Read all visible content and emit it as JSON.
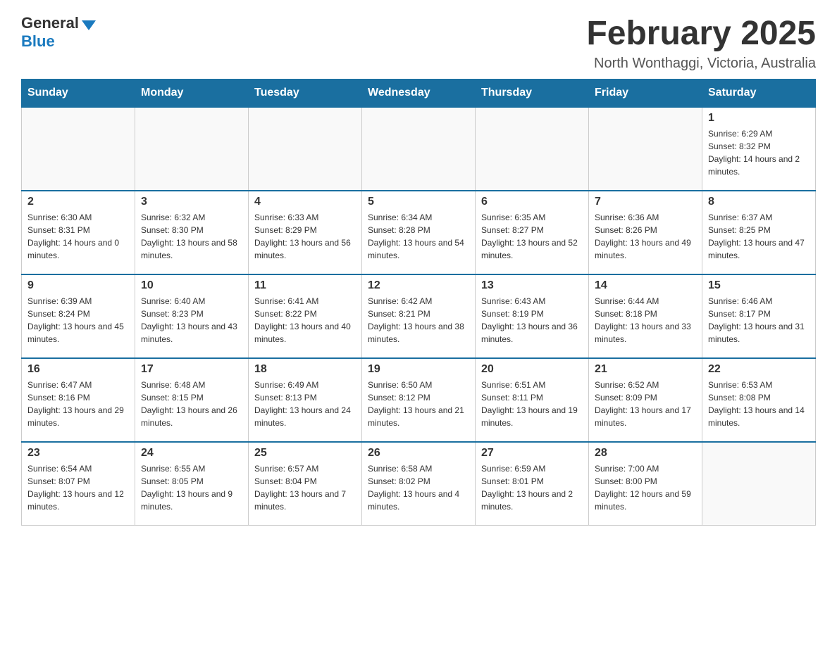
{
  "header": {
    "logo_general": "General",
    "logo_blue": "Blue",
    "title": "February 2025",
    "location": "North Wonthaggi, Victoria, Australia"
  },
  "days_of_week": [
    "Sunday",
    "Monday",
    "Tuesday",
    "Wednesday",
    "Thursday",
    "Friday",
    "Saturday"
  ],
  "weeks": [
    [
      {
        "day": "",
        "info": ""
      },
      {
        "day": "",
        "info": ""
      },
      {
        "day": "",
        "info": ""
      },
      {
        "day": "",
        "info": ""
      },
      {
        "day": "",
        "info": ""
      },
      {
        "day": "",
        "info": ""
      },
      {
        "day": "1",
        "info": "Sunrise: 6:29 AM\nSunset: 8:32 PM\nDaylight: 14 hours and 2 minutes."
      }
    ],
    [
      {
        "day": "2",
        "info": "Sunrise: 6:30 AM\nSunset: 8:31 PM\nDaylight: 14 hours and 0 minutes."
      },
      {
        "day": "3",
        "info": "Sunrise: 6:32 AM\nSunset: 8:30 PM\nDaylight: 13 hours and 58 minutes."
      },
      {
        "day": "4",
        "info": "Sunrise: 6:33 AM\nSunset: 8:29 PM\nDaylight: 13 hours and 56 minutes."
      },
      {
        "day": "5",
        "info": "Sunrise: 6:34 AM\nSunset: 8:28 PM\nDaylight: 13 hours and 54 minutes."
      },
      {
        "day": "6",
        "info": "Sunrise: 6:35 AM\nSunset: 8:27 PM\nDaylight: 13 hours and 52 minutes."
      },
      {
        "day": "7",
        "info": "Sunrise: 6:36 AM\nSunset: 8:26 PM\nDaylight: 13 hours and 49 minutes."
      },
      {
        "day": "8",
        "info": "Sunrise: 6:37 AM\nSunset: 8:25 PM\nDaylight: 13 hours and 47 minutes."
      }
    ],
    [
      {
        "day": "9",
        "info": "Sunrise: 6:39 AM\nSunset: 8:24 PM\nDaylight: 13 hours and 45 minutes."
      },
      {
        "day": "10",
        "info": "Sunrise: 6:40 AM\nSunset: 8:23 PM\nDaylight: 13 hours and 43 minutes."
      },
      {
        "day": "11",
        "info": "Sunrise: 6:41 AM\nSunset: 8:22 PM\nDaylight: 13 hours and 40 minutes."
      },
      {
        "day": "12",
        "info": "Sunrise: 6:42 AM\nSunset: 8:21 PM\nDaylight: 13 hours and 38 minutes."
      },
      {
        "day": "13",
        "info": "Sunrise: 6:43 AM\nSunset: 8:19 PM\nDaylight: 13 hours and 36 minutes."
      },
      {
        "day": "14",
        "info": "Sunrise: 6:44 AM\nSunset: 8:18 PM\nDaylight: 13 hours and 33 minutes."
      },
      {
        "day": "15",
        "info": "Sunrise: 6:46 AM\nSunset: 8:17 PM\nDaylight: 13 hours and 31 minutes."
      }
    ],
    [
      {
        "day": "16",
        "info": "Sunrise: 6:47 AM\nSunset: 8:16 PM\nDaylight: 13 hours and 29 minutes."
      },
      {
        "day": "17",
        "info": "Sunrise: 6:48 AM\nSunset: 8:15 PM\nDaylight: 13 hours and 26 minutes."
      },
      {
        "day": "18",
        "info": "Sunrise: 6:49 AM\nSunset: 8:13 PM\nDaylight: 13 hours and 24 minutes."
      },
      {
        "day": "19",
        "info": "Sunrise: 6:50 AM\nSunset: 8:12 PM\nDaylight: 13 hours and 21 minutes."
      },
      {
        "day": "20",
        "info": "Sunrise: 6:51 AM\nSunset: 8:11 PM\nDaylight: 13 hours and 19 minutes."
      },
      {
        "day": "21",
        "info": "Sunrise: 6:52 AM\nSunset: 8:09 PM\nDaylight: 13 hours and 17 minutes."
      },
      {
        "day": "22",
        "info": "Sunrise: 6:53 AM\nSunset: 8:08 PM\nDaylight: 13 hours and 14 minutes."
      }
    ],
    [
      {
        "day": "23",
        "info": "Sunrise: 6:54 AM\nSunset: 8:07 PM\nDaylight: 13 hours and 12 minutes."
      },
      {
        "day": "24",
        "info": "Sunrise: 6:55 AM\nSunset: 8:05 PM\nDaylight: 13 hours and 9 minutes."
      },
      {
        "day": "25",
        "info": "Sunrise: 6:57 AM\nSunset: 8:04 PM\nDaylight: 13 hours and 7 minutes."
      },
      {
        "day": "26",
        "info": "Sunrise: 6:58 AM\nSunset: 8:02 PM\nDaylight: 13 hours and 4 minutes."
      },
      {
        "day": "27",
        "info": "Sunrise: 6:59 AM\nSunset: 8:01 PM\nDaylight: 13 hours and 2 minutes."
      },
      {
        "day": "28",
        "info": "Sunrise: 7:00 AM\nSunset: 8:00 PM\nDaylight: 12 hours and 59 minutes."
      },
      {
        "day": "",
        "info": ""
      }
    ]
  ]
}
